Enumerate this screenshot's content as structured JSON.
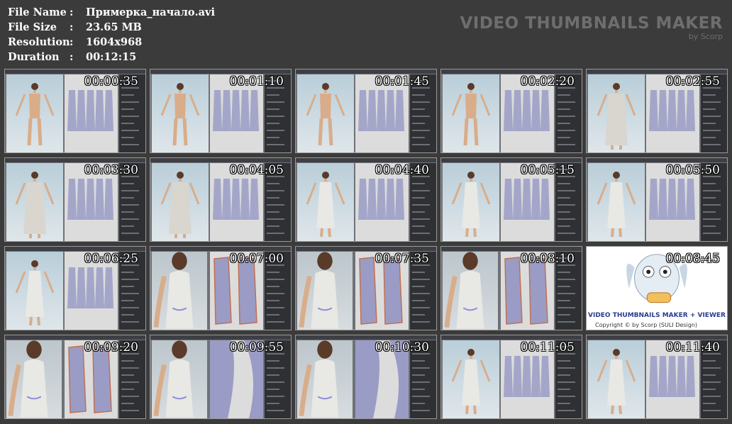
{
  "info": {
    "rows": [
      {
        "label": "File Name",
        "sep": ":",
        "value": "Примерка_начало.avi"
      },
      {
        "label": "File Size",
        "sep": ":",
        "value": "23.65 MB"
      },
      {
        "label": "Resolution",
        "sep": ":",
        "value": "1604x968"
      },
      {
        "label": "Duration",
        "sep": ":",
        "value": "00:12:15"
      }
    ]
  },
  "brand": {
    "title": "VIDEO THUMBNAILS MAKER",
    "subtitle": "by Scorp"
  },
  "thumbnails": [
    {
      "time": "00:00:35",
      "scene": "body-front"
    },
    {
      "time": "00:01:10",
      "scene": "body-front"
    },
    {
      "time": "00:01:45",
      "scene": "body-front"
    },
    {
      "time": "00:02:20",
      "scene": "body-front"
    },
    {
      "time": "00:02:55",
      "scene": "coat"
    },
    {
      "time": "00:03:30",
      "scene": "coat"
    },
    {
      "time": "00:04:05",
      "scene": "coat"
    },
    {
      "time": "00:04:40",
      "scene": "dress"
    },
    {
      "time": "00:05:15",
      "scene": "dress"
    },
    {
      "time": "00:05:50",
      "scene": "dress-angle"
    },
    {
      "time": "00:06:25",
      "scene": "dress-angle"
    },
    {
      "time": "00:07:00",
      "scene": "closeup-pattern"
    },
    {
      "time": "00:07:35",
      "scene": "closeup-pattern"
    },
    {
      "time": "00:08:10",
      "scene": "closeup-pattern"
    },
    {
      "time": "00:08:45",
      "scene": "owl-logo"
    },
    {
      "time": "00:09:20",
      "scene": "closeup-pattern"
    },
    {
      "time": "00:09:55",
      "scene": "closeup-zoom"
    },
    {
      "time": "00:10:30",
      "scene": "closeup-zoom"
    },
    {
      "time": "00:11:05",
      "scene": "dress-back"
    },
    {
      "time": "00:11:40",
      "scene": "dress-back"
    }
  ],
  "owl": {
    "title": "VIDEO THUMBNAILS MAKER + VIEWER",
    "copyright": "Copyright © by Scorp (SULI Design)"
  },
  "colors": {
    "background": "#3b3b3b",
    "brand": "#6e6e6e",
    "skin": "#d9ad8a",
    "garment": "#e8e8e4",
    "pattern-piece": "#9a9cc6"
  }
}
